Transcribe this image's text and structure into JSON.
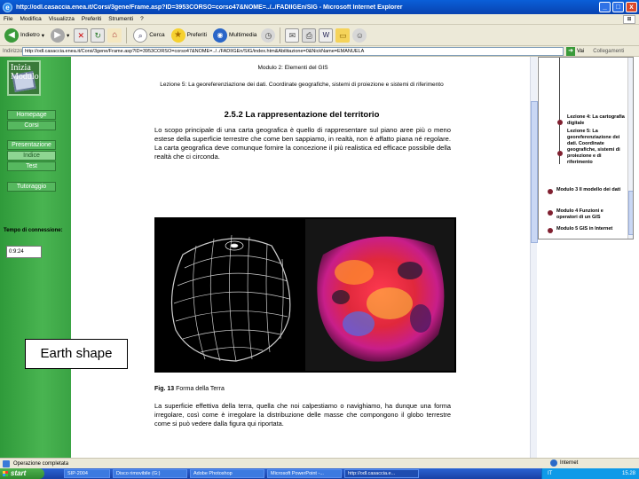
{
  "window": {
    "title": "http://odl.casaccia.enea.it/Corsi/3gene/Frame.asp?ID=3953CORSO=corso47&NOME=../../FADIIGEn/SIG - Microsoft Internet Explorer",
    "min": "_",
    "max": "□",
    "close": "x"
  },
  "menu": [
    "File",
    "Modifica",
    "Visualizza",
    "Preferiti",
    "Strumenti",
    "?"
  ],
  "toolbar": {
    "back": "Indietro",
    "search": "Cerca",
    "favorites": "Preferiti",
    "media": "Multimedia"
  },
  "address": {
    "label": "Indirizzo",
    "url": "http://odl.casaccia.enea.it/Corsi/3gene/Frame.asp?ID=3953CORSO=corso47&NOME=../../FADIIGEn/SIG/index.htm&Abilitazione=0&NickName=EMANUELA",
    "go": "Vai",
    "links": "Collegamenti"
  },
  "sidebar": {
    "logo_line1": "Inizia",
    "logo_line2": "Modulo",
    "links": [
      {
        "label": "Homepage"
      },
      {
        "label": "Corsi"
      },
      {
        "label": "Presentazione"
      },
      {
        "label": "Indice"
      },
      {
        "label": "Test"
      },
      {
        "label": "Tutoraggio"
      }
    ],
    "time_label": "Tempo di connessione:",
    "time_value": "0:9:24"
  },
  "caption_box": "Earth shape",
  "main": {
    "module": "Modulo 2: Elementi del GIS",
    "lesson": "Lezione 5: La georeferenziazione dei dati. Coordinate geografiche, sistemi di proiezione e sistemi di riferimento",
    "section": "2.5.2 La rappresentazione del territorio",
    "paragraph": "Lo scopo principale di una carta geografica è quello di rappresentare sul piano aree più o meno estese della superficie terrestre che come ben sappiamo, in realtà, non è affatto piana né regolare. La carta geografica deve comunque fornire la concezione il più realistica ed efficace possibile della realtà che ci circonda.",
    "fig_num": "Fig. 13",
    "fig_text": "Forma della Terra",
    "paragraph2": "La superficie effettiva della terra, quella che noi calpestiamo o navighiamo, ha dunque una forma irregolare, così come è irregolare la distribuzione delle masse che compongono il globo terrestre come si può vedere dalla figura qui riportata."
  },
  "rightnav": {
    "items": [
      "Lezione 4: La cartografia digitale",
      "Lezione 5: La georeferenziazione dei dati. Coordinate geografiche, sistemi di proiezione e di riferimento",
      "Modulo 3 Il modello dei dati",
      "Modulo 4 Funzioni e operatori di un GIS",
      "Modulo 5 GIS in Internet"
    ]
  },
  "status": {
    "text": "Operazione completata",
    "zone": "Internet"
  },
  "taskbar": {
    "start": "start",
    "tasks": [
      "SIP-2004",
      "Disco rimovibile (G:)",
      "Adobe Photoshop",
      "Microsoft PowerPoint -...",
      "http://odl.casaccia.e..."
    ],
    "lang": "IT",
    "clock": "15.28"
  },
  "colors": {
    "sidebar_green": "#3aa344",
    "titlebar_blue": "#0a5fd8",
    "bullet": "#802030"
  },
  "icons": [
    "ie-icon",
    "back-icon",
    "forward-icon",
    "stop-icon",
    "refresh-icon",
    "home-icon",
    "search-icon",
    "favorites-icon",
    "media-icon",
    "history-icon",
    "mail-icon",
    "print-icon",
    "edit-icon",
    "folder-icon",
    "go-icon",
    "globe-icon",
    "windows-flag-icon"
  ]
}
